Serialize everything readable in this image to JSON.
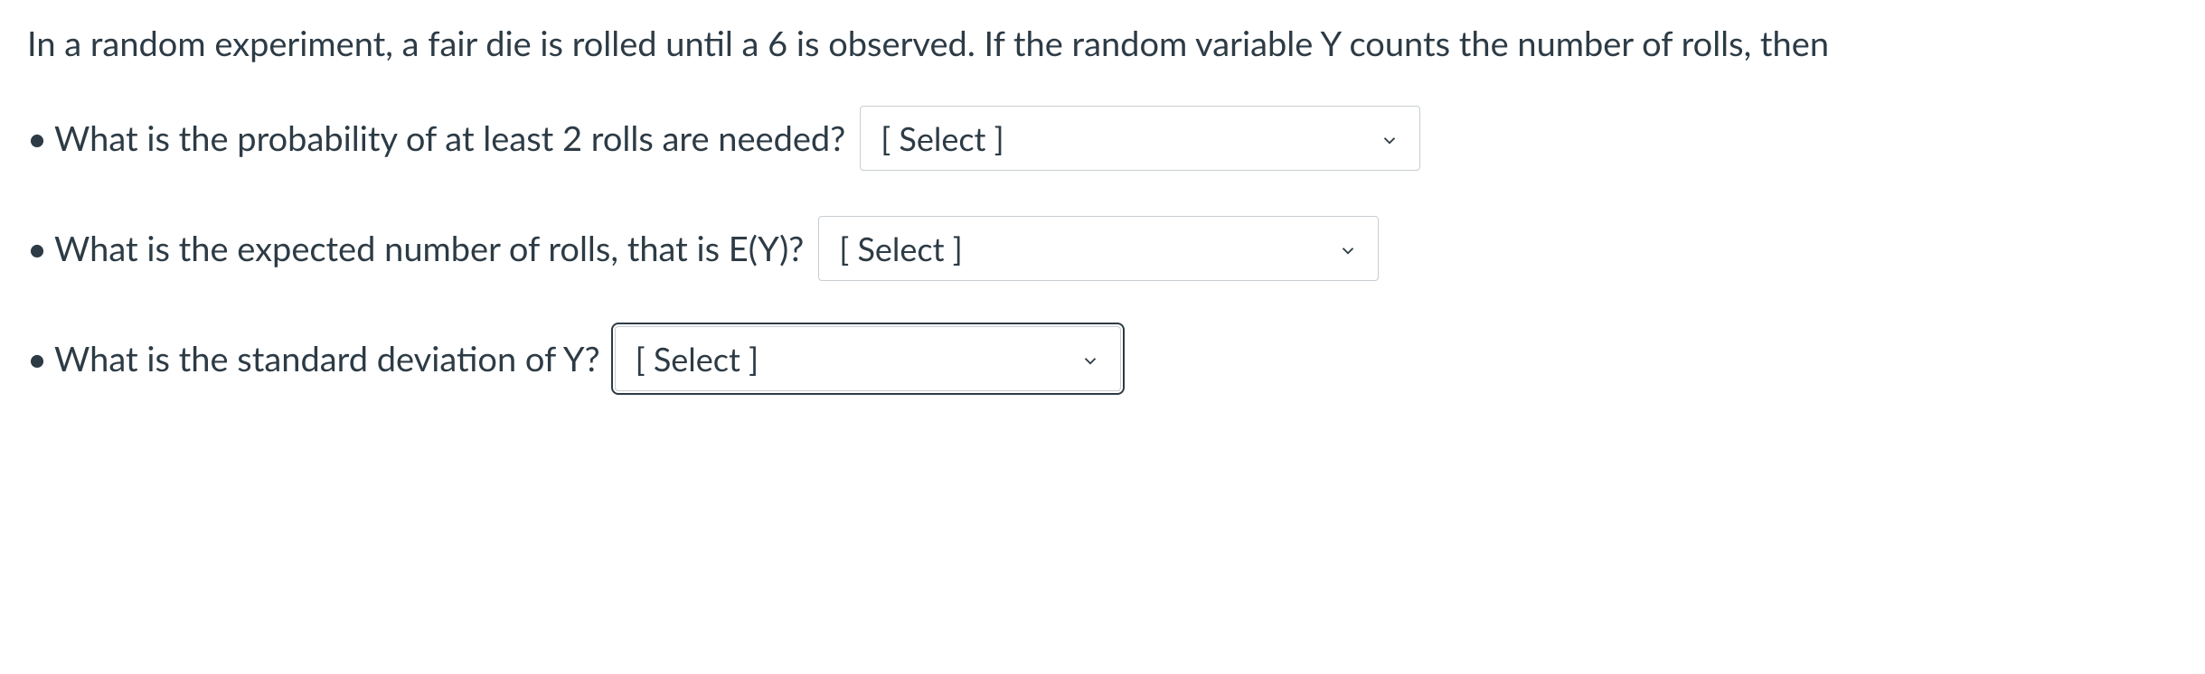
{
  "intro": "In a random experiment, a fair die is rolled until a 6 is observed. If the random variable Y counts the number of rolls, then",
  "questions": [
    {
      "text": "What is the probability of at least 2 rolls are needed?",
      "select_placeholder": "[ Select ]"
    },
    {
      "text": "What is the expected number of rolls, that is E(Y)?",
      "select_placeholder": "[ Select ]"
    },
    {
      "text": "What is the standard deviation of Y?",
      "select_placeholder": "[ Select ]"
    }
  ]
}
